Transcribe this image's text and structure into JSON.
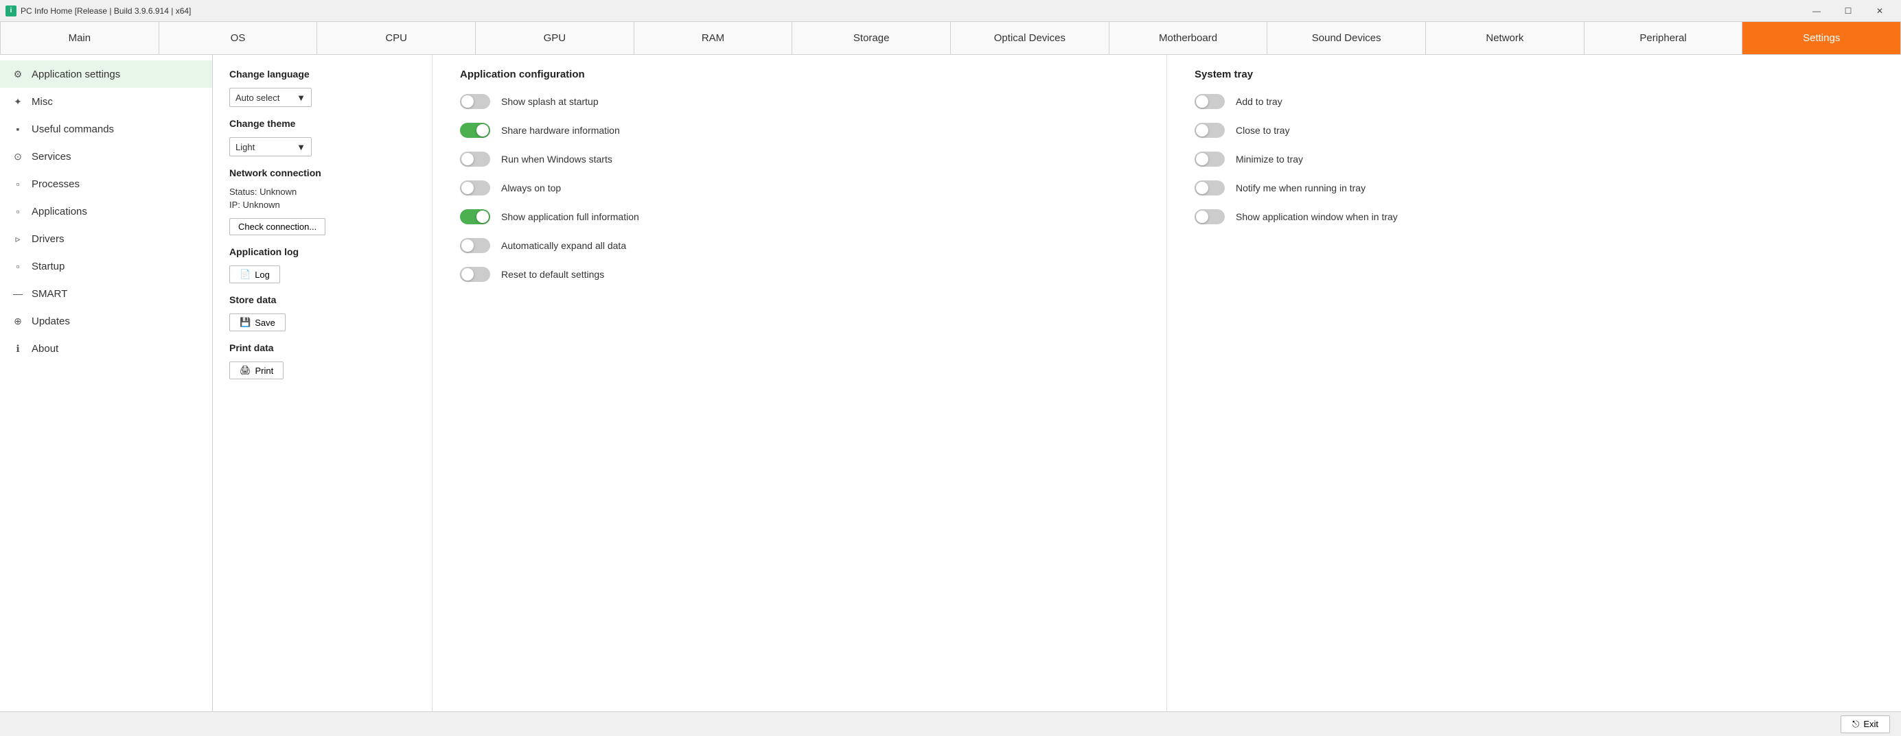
{
  "titleBar": {
    "title": "PC Info Home [Release | Build 3.9.6.914 | x64]",
    "iconText": "i",
    "minimize": "—",
    "restore": "☐",
    "close": "✕"
  },
  "navTabs": [
    {
      "label": "Main",
      "active": false
    },
    {
      "label": "OS",
      "active": false
    },
    {
      "label": "CPU",
      "active": false
    },
    {
      "label": "GPU",
      "active": false
    },
    {
      "label": "RAM",
      "active": false
    },
    {
      "label": "Storage",
      "active": false
    },
    {
      "label": "Optical Devices",
      "active": false
    },
    {
      "label": "Motherboard",
      "active": false
    },
    {
      "label": "Sound Devices",
      "active": false
    },
    {
      "label": "Network",
      "active": false
    },
    {
      "label": "Peripheral",
      "active": false
    },
    {
      "label": "Settings",
      "active": true
    }
  ],
  "sidebar": {
    "items": [
      {
        "label": "Application settings",
        "icon": "⚙",
        "active": true
      },
      {
        "label": "Misc",
        "icon": "✦",
        "active": false
      },
      {
        "label": "Useful commands",
        "icon": "▪",
        "active": false
      },
      {
        "label": "Services",
        "icon": "⊙",
        "active": false
      },
      {
        "label": "Processes",
        "icon": "▫",
        "active": false
      },
      {
        "label": "Applications",
        "icon": "▫",
        "active": false
      },
      {
        "label": "Drivers",
        "icon": "▹",
        "active": false
      },
      {
        "label": "Startup",
        "icon": "▫",
        "active": false
      },
      {
        "label": "SMART",
        "icon": "—",
        "active": false
      },
      {
        "label": "Updates",
        "icon": "⊕",
        "active": false
      },
      {
        "label": "About",
        "icon": "ℹ",
        "active": false
      }
    ]
  },
  "settingsLeft": {
    "changeLanguage": "Change language",
    "languageValue": "Auto select",
    "changeTheme": "Change theme",
    "themeValue": "Light",
    "networkConnection": "Network connection",
    "statusText": "Status: Unknown",
    "ipText": "IP: Unknown",
    "checkConnectionBtn": "Check connection...",
    "applicationLog": "Application log",
    "logBtn": "Log",
    "storeData": "Store data",
    "saveBtn": "Save",
    "printData": "Print data",
    "printBtn": "Print"
  },
  "appConfig": {
    "heading": "Application configuration",
    "rows": [
      {
        "label": "Show splash at startup",
        "on": false
      },
      {
        "label": "Share hardware information",
        "on": true
      },
      {
        "label": "Run when Windows starts",
        "on": false
      },
      {
        "label": "Always on top",
        "on": false
      },
      {
        "label": "Show application full information",
        "on": true
      },
      {
        "label": "Automatically expand all data",
        "on": false
      },
      {
        "label": "Reset to default settings",
        "on": false
      }
    ]
  },
  "systemTray": {
    "heading": "System tray",
    "rows": [
      {
        "label": "Add to tray",
        "on": false
      },
      {
        "label": "Close to tray",
        "on": false
      },
      {
        "label": "Minimize to tray",
        "on": false
      },
      {
        "label": "Notify me when running in tray",
        "on": false
      },
      {
        "label": "Show application window when in tray",
        "on": false
      }
    ]
  },
  "footer": {
    "exitBtn": "Exit",
    "exitIcon": "🚪"
  }
}
